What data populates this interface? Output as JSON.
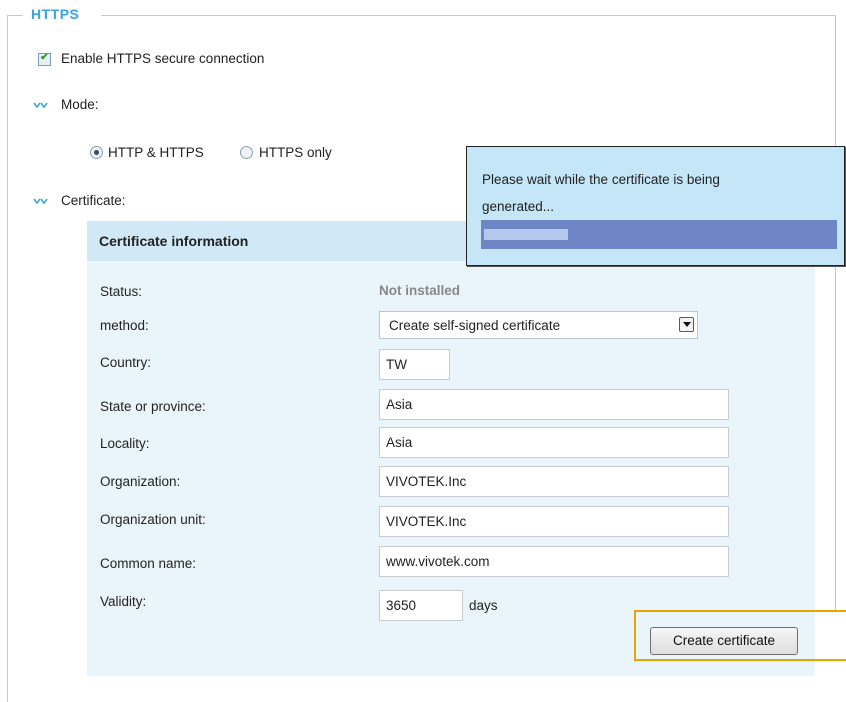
{
  "section": {
    "legend": "HTTPS"
  },
  "enable_https": {
    "label": "Enable HTTPS secure connection",
    "checked": true
  },
  "mode": {
    "label": "Mode:",
    "options": [
      {
        "label": "HTTP & HTTPS",
        "selected": true
      },
      {
        "label": "HTTPS only",
        "selected": false
      }
    ]
  },
  "certificate": {
    "label": "Certificate:",
    "panel_title": "Certificate information",
    "status_label": "Status:",
    "status_value": "Not installed",
    "method_label": "method:",
    "method_value": "Create self-signed certificate",
    "fields": {
      "country": {
        "label": "Country:",
        "value": "TW"
      },
      "state": {
        "label": "State or province:",
        "value": "Asia"
      },
      "locality": {
        "label": "Locality:",
        "value": "Asia"
      },
      "organization": {
        "label": "Organization:",
        "value": "VIVOTEK.Inc"
      },
      "org_unit": {
        "label": "Organization unit:",
        "value": "VIVOTEK.Inc"
      },
      "common_name": {
        "label": "Common name:",
        "value": "www.vivotek.com"
      },
      "validity": {
        "label": "Validity:",
        "value": "3650",
        "unit": "days"
      }
    },
    "create_button": "Create certificate"
  },
  "popup": {
    "line1": "Please wait while the certificate is being",
    "line2": "generated...",
    "progress": 0.24
  },
  "colors": {
    "accent": "#3aa3e3",
    "highlight": "#e8a400",
    "panel_bg": "#eaf5fb",
    "panel_header": "#d1e9f6",
    "popup_bg": "#c5e6f7",
    "progress_track": "#6f86c6",
    "progress_fill": "#b6c7ee"
  }
}
